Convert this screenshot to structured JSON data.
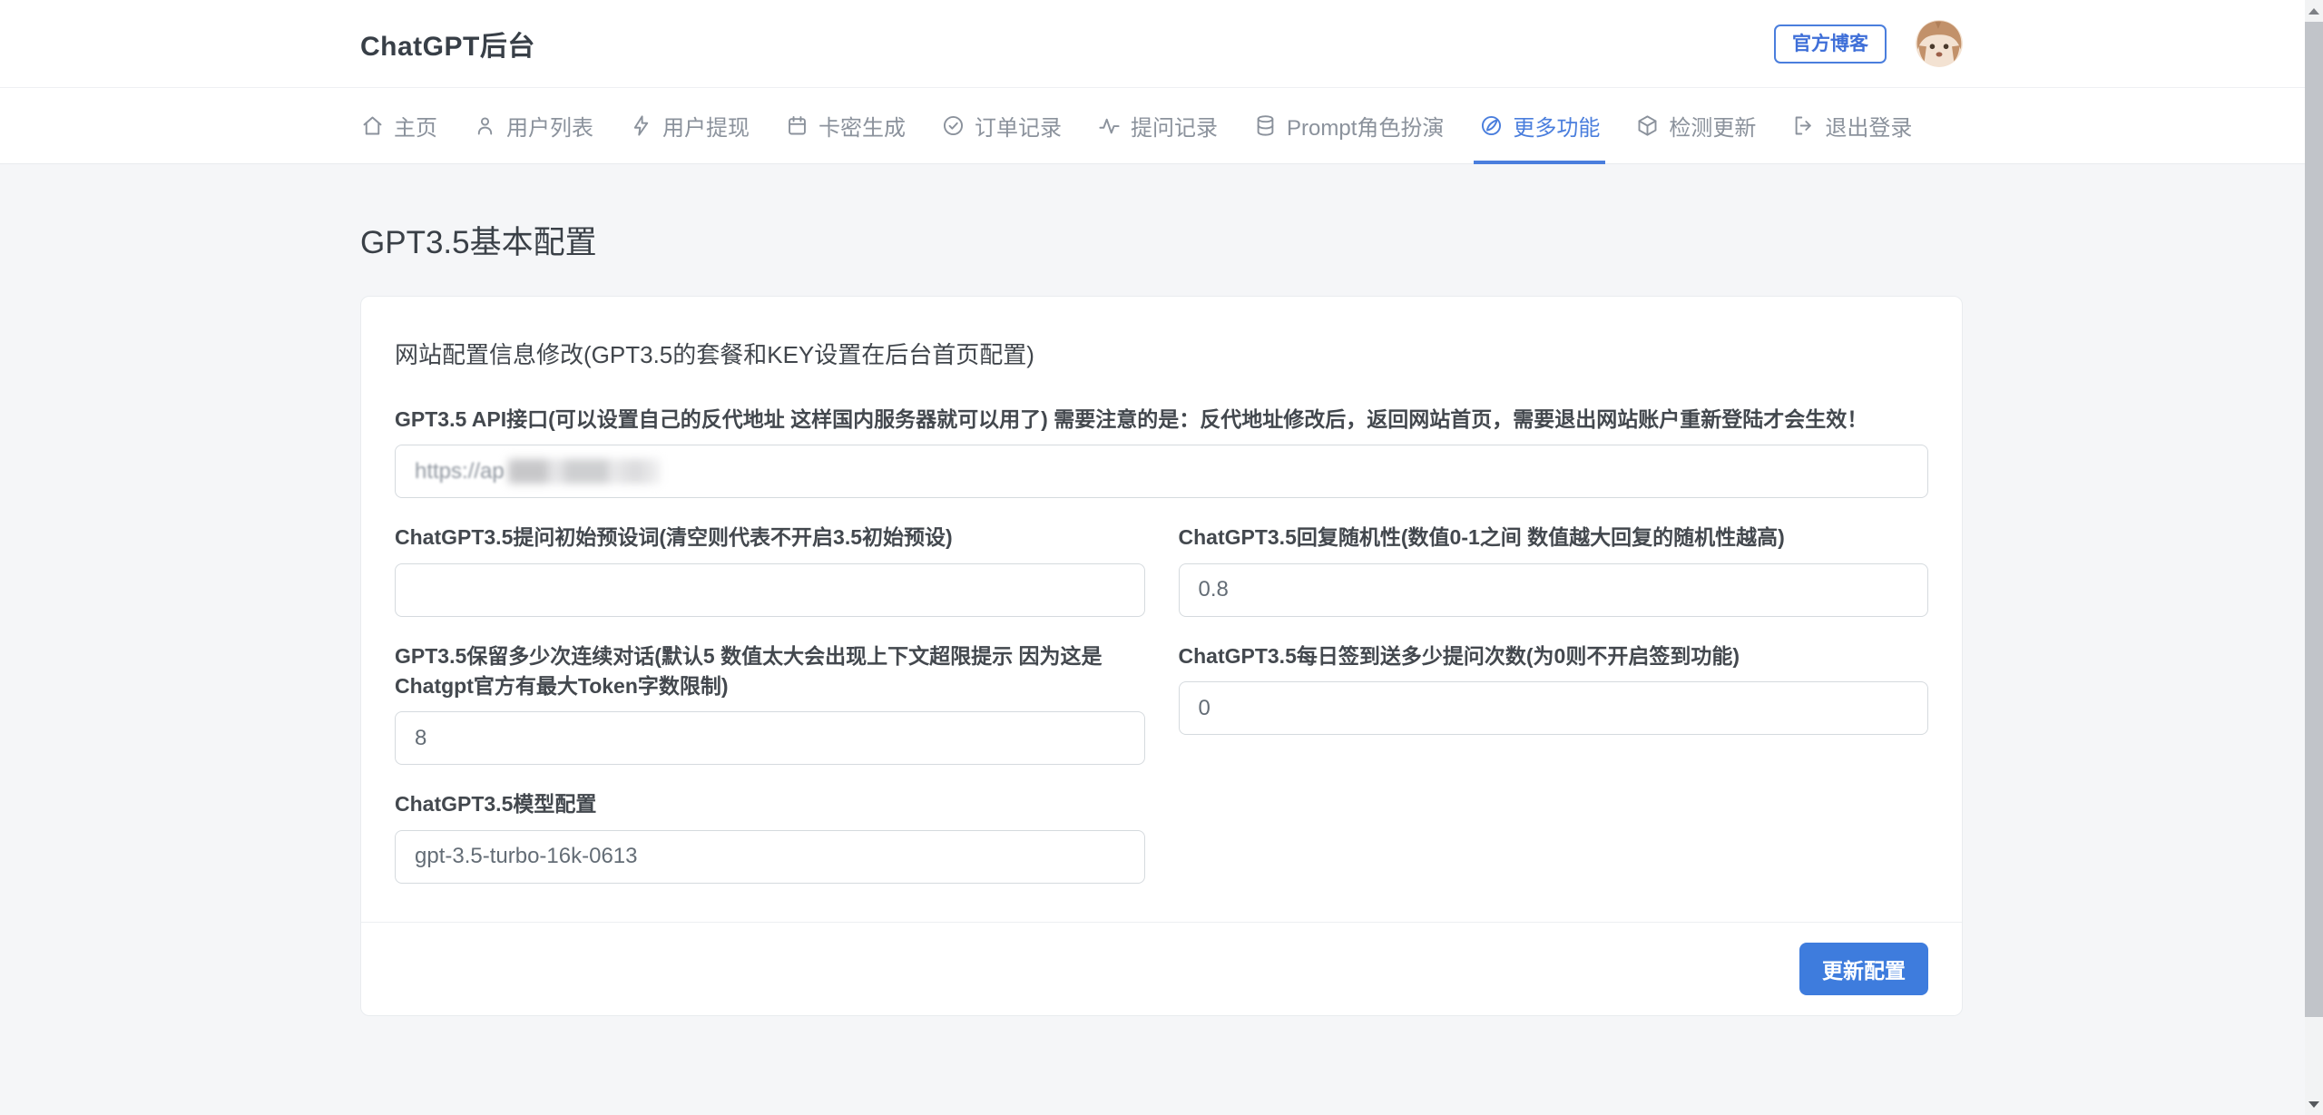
{
  "header": {
    "title": "ChatGPT后台",
    "blog_button_label": "官方博客"
  },
  "nav": {
    "items": [
      {
        "label": "主页",
        "icon": "home-icon",
        "active": false
      },
      {
        "label": "用户列表",
        "icon": "user-icon",
        "active": false
      },
      {
        "label": "用户提现",
        "icon": "lightning-icon",
        "active": false
      },
      {
        "label": "卡密生成",
        "icon": "calendar-icon",
        "active": false
      },
      {
        "label": "订单记录",
        "icon": "check-circle-icon",
        "active": false
      },
      {
        "label": "提问记录",
        "icon": "activity-icon",
        "active": false
      },
      {
        "label": "Prompt角色扮演",
        "icon": "database-icon",
        "active": false
      },
      {
        "label": "更多功能",
        "icon": "quill-circle-icon",
        "active": true
      },
      {
        "label": "检测更新",
        "icon": "cube-icon",
        "active": false
      },
      {
        "label": "退出登录",
        "icon": "logout-icon",
        "active": false
      }
    ]
  },
  "page": {
    "title": "GPT3.5基本配置"
  },
  "card": {
    "heading": "网站配置信息修改(GPT3.5的套餐和KEY设置在后台首页配置)",
    "fields": {
      "api": {
        "label": "GPT3.5 API接口(可以设置自己的反代地址 这样国内服务器就可以用了) 需要注意的是：反代地址修改后，返回网站首页，需要退出网站账户重新登陆才会生效！",
        "value": "https://ap",
        "redacted": true
      },
      "preset": {
        "label": "ChatGPT3.5提问初始预设词(清空则代表不开启3.5初始预设)",
        "value": ""
      },
      "randomness": {
        "label": "ChatGPT3.5回复随机性(数值0-1之间 数值越大回复的随机性越高)",
        "value": "0.8"
      },
      "context_rounds": {
        "label": "GPT3.5保留多少次连续对话(默认5 数值太大会出现上下文超限提示 因为这是Chatgpt官方有最大Token字数限制)",
        "value": "8"
      },
      "daily_signin": {
        "label": "ChatGPT3.5每日签到送多少提问次数(为0则不开启签到功能)",
        "value": "0"
      },
      "model": {
        "label": "ChatGPT3.5模型配置",
        "value": "gpt-3.5-turbo-16k-0613"
      }
    },
    "submit_label": "更新配置"
  },
  "colors": {
    "accent_blue": "#4a7edd",
    "button_blue": "#3e7cdd",
    "nav_gray": "#8b929c",
    "page_background": "#f5f6f8"
  }
}
